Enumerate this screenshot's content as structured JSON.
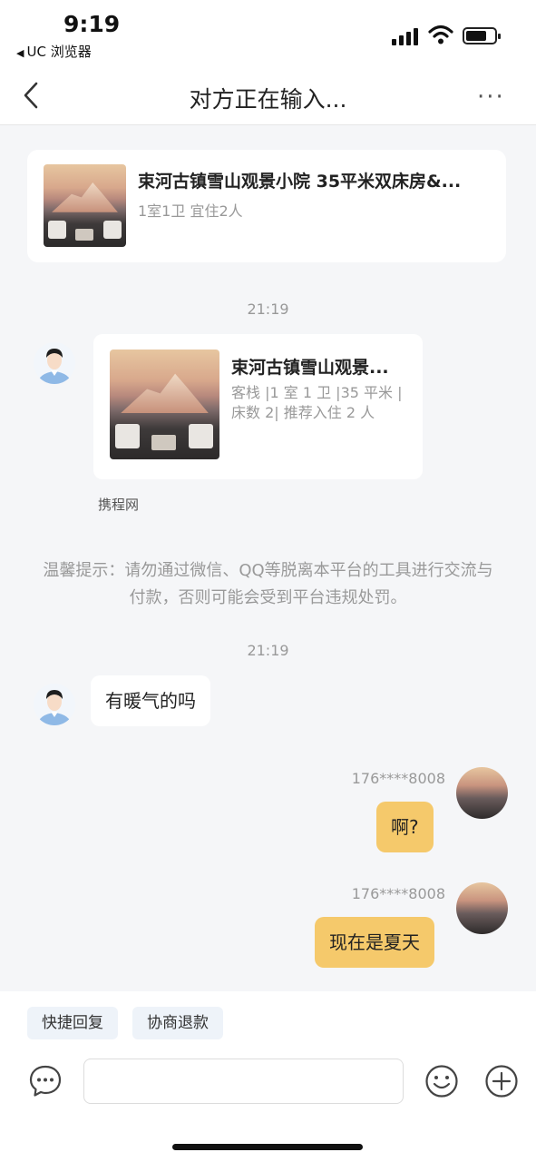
{
  "status_bar": {
    "time": "9:19",
    "back_app": "UC 浏览器"
  },
  "header": {
    "title": "对方正在输入..."
  },
  "product_card": {
    "title": "束河古镇雪山观景小院 35平米双床房&...",
    "subtitle": "1室1卫 宜住2人"
  },
  "messages": {
    "timestamp_1": "21:19",
    "shared_listing": {
      "title": "束河古镇雪山观景...",
      "description": "客栈 |1 室 1 卫 |35 平米 | 床数 2| 推荐入住 2 人",
      "source": "携程网"
    },
    "notice": "温馨提示：请勿通过微信、QQ等脱离本平台的工具进行交流与付款，否则可能会受到平台违规处罚。",
    "timestamp_2": "21:19",
    "incoming_text": "有暖气的吗",
    "outgoing": [
      {
        "sender": "176****8008",
        "text": "啊?"
      },
      {
        "sender": "176****8008",
        "text": "现在是夏天"
      }
    ]
  },
  "bottom_bar": {
    "quick_reply_label": "快捷回复",
    "refund_label": "协商退款",
    "input_placeholder": ""
  },
  "colors": {
    "outgoing_bubble": "#f5c96b",
    "background": "#f5f6f8"
  }
}
